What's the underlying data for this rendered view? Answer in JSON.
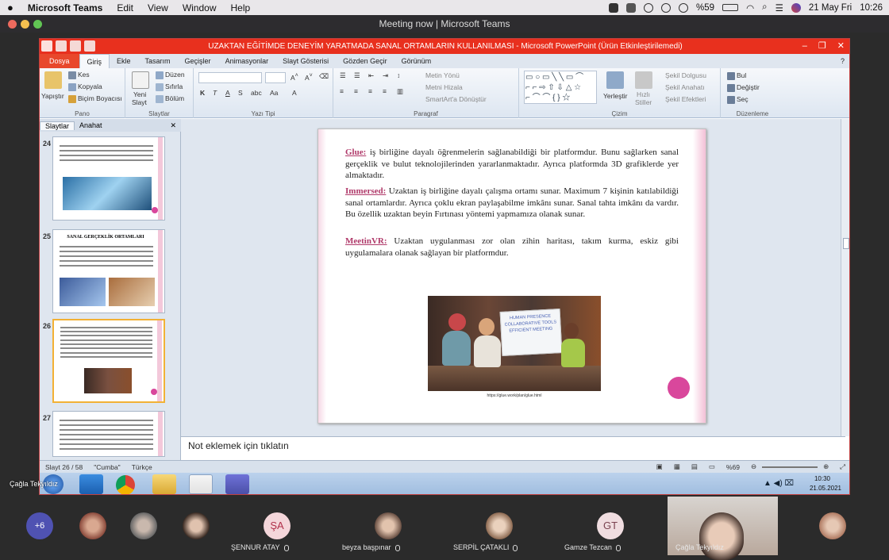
{
  "menubar": {
    "app_name": "Microsoft Teams",
    "items": [
      "Edit",
      "View",
      "Window",
      "Help"
    ],
    "battery": "%59",
    "date": "21 May Fri",
    "time": "10:26"
  },
  "teams_window": {
    "title": "Meeting now | Microsoft Teams"
  },
  "powerpoint": {
    "title": "UZAKTAN EĞİTİMDE DENEYİM YARATMADA SANAL ORTAMLARIN KULLANILMASI  -  Microsoft PowerPoint (Ürün Etkinleştirilemedi)",
    "tabs": [
      "Dosya",
      "Giriş",
      "Ekle",
      "Tasarım",
      "Geçişler",
      "Animasyonlar",
      "Slayt Gösterisi",
      "Gözden Geçir",
      "Görünüm"
    ],
    "ribbon": {
      "clipboard": {
        "paste": "Yapıştır",
        "cut": "Kes",
        "copy": "Kopyala",
        "format": "Biçim Boyacısı",
        "label": "Pano"
      },
      "slides": {
        "new": "Yeni",
        "new2": "Slayt",
        "layout": "Düzen",
        "reset": "Sıfırla",
        "section": "Bölüm",
        "label": "Slaytlar"
      },
      "font": {
        "label": "Yazı Tipi"
      },
      "paragraph": {
        "text_dir": "Metin Yönü",
        "align_text": "Metni Hizala",
        "smartart": "SmartArt'a Dönüştür",
        "label": "Paragraf"
      },
      "drawing": {
        "arrange": "Yerleştir",
        "quick": "Hızlı",
        "quick2": "Stiller",
        "fill": "Şekil Dolgusu",
        "outline": "Şekil Anahatı",
        "effects": "Şekil Efektleri",
        "label": "Çizim"
      },
      "editing": {
        "find": "Bul",
        "replace": "Değiştir",
        "select": "Seç",
        "label": "Düzenleme"
      }
    },
    "left_panel": {
      "tabs": [
        "Slaytlar",
        "Anahat"
      ],
      "thumbnails": [
        {
          "num": "24"
        },
        {
          "num": "25",
          "title": "SANAL GERÇEKLİK ORTAMLARI"
        },
        {
          "num": "26"
        },
        {
          "num": "27"
        }
      ]
    },
    "slide": {
      "paragraphs": [
        {
          "keyword": "Glue:",
          "text": " iş birliğine dayalı öğrenmelerin sağlanabildiği bir platformdur. Bunu sağlarken sanal gerçeklik ve bulut teknolojilerinden yararlanmaktadır. Ayrıca platformda 3D grafiklerde yer almaktadır."
        },
        {
          "keyword": "Immersed:",
          "text": " Uzaktan iş birliğine dayalı çalışma ortamı sunar. Maximum 7 kişinin katılabildiği sanal ortamlardır. Ayrıca çoklu ekran paylaşabilme imkânı sunar. Sanal tahta imkânı da vardır. Bu özellik uzaktan beyin Fırtınası yöntemi yapmamıza olanak sunar."
        },
        {
          "keyword": "MeetinVR:",
          "text": " Uzaktan uygulanması zor olan  zihin haritası, takım kurma, eskiz gibi uygulamalara olanak sağlayan bir platformdur."
        }
      ],
      "image_board_text": [
        "HUMAN PRESENCE",
        "COLLABORATIVE TOOLS",
        "EFFICIENT MEETING"
      ],
      "image_caption": "https://glue.work/plan/glue.html"
    },
    "notes_placeholder": "Not eklemek için tıklatın",
    "status": {
      "slide": "Slayt 26 / 58",
      "theme": "\"Cumba\"",
      "language": "Türkçe",
      "zoom": "%69"
    },
    "taskbar": {
      "time": "10:30",
      "date": "21.05.2021"
    }
  },
  "presenter_label": "Çağla Tekyıldız",
  "participants": [
    {
      "initials": "+6",
      "name": "",
      "color": "#4f52b2"
    },
    {
      "initials": "",
      "name": "",
      "color": "#8b4a3c"
    },
    {
      "initials": "",
      "name": "",
      "color": "#777777"
    },
    {
      "initials": "",
      "name": "",
      "color": "#4a3a33"
    },
    {
      "initials": "ŞA",
      "name": "ŞENNUR ATAY",
      "color": "#f4d6da"
    },
    {
      "initials": "",
      "name": "beyza başpınar",
      "color": "#6a5044"
    },
    {
      "initials": "",
      "name": "SERPİL ÇATAKLI",
      "color": "#8d6a52"
    },
    {
      "initials": "GT",
      "name": "Gamze Tezcan",
      "color": "#f0dde0"
    },
    {
      "initials": "",
      "name": "Çağla Tekyıldız",
      "color": "#c9b4a8"
    },
    {
      "initials": "",
      "name": "",
      "color": "#b07a62"
    }
  ]
}
